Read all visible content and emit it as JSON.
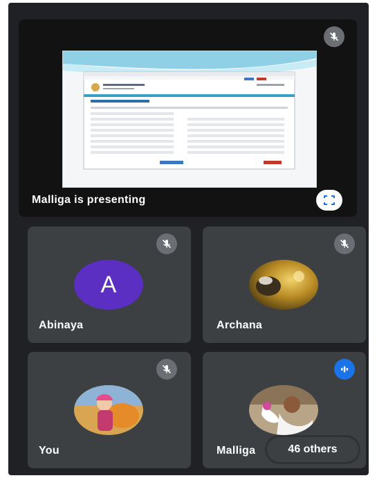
{
  "presentation": {
    "caption": "Malliga is presenting",
    "fullscreen_icon": "fullscreen-icon",
    "mic_icon": "mic-off-icon"
  },
  "participants": [
    {
      "name": "Abinaya",
      "initial": "A",
      "mic": "muted",
      "avatar_color": "#5a2fc2"
    },
    {
      "name": "Archana",
      "mic": "muted"
    },
    {
      "name": "You",
      "mic": "muted"
    },
    {
      "name": "Malliga",
      "mic": "speaking"
    }
  ],
  "others": {
    "label": "46 others"
  },
  "colors": {
    "background": "#202124",
    "tile": "#3c4043",
    "accent": "#1a73e8"
  }
}
